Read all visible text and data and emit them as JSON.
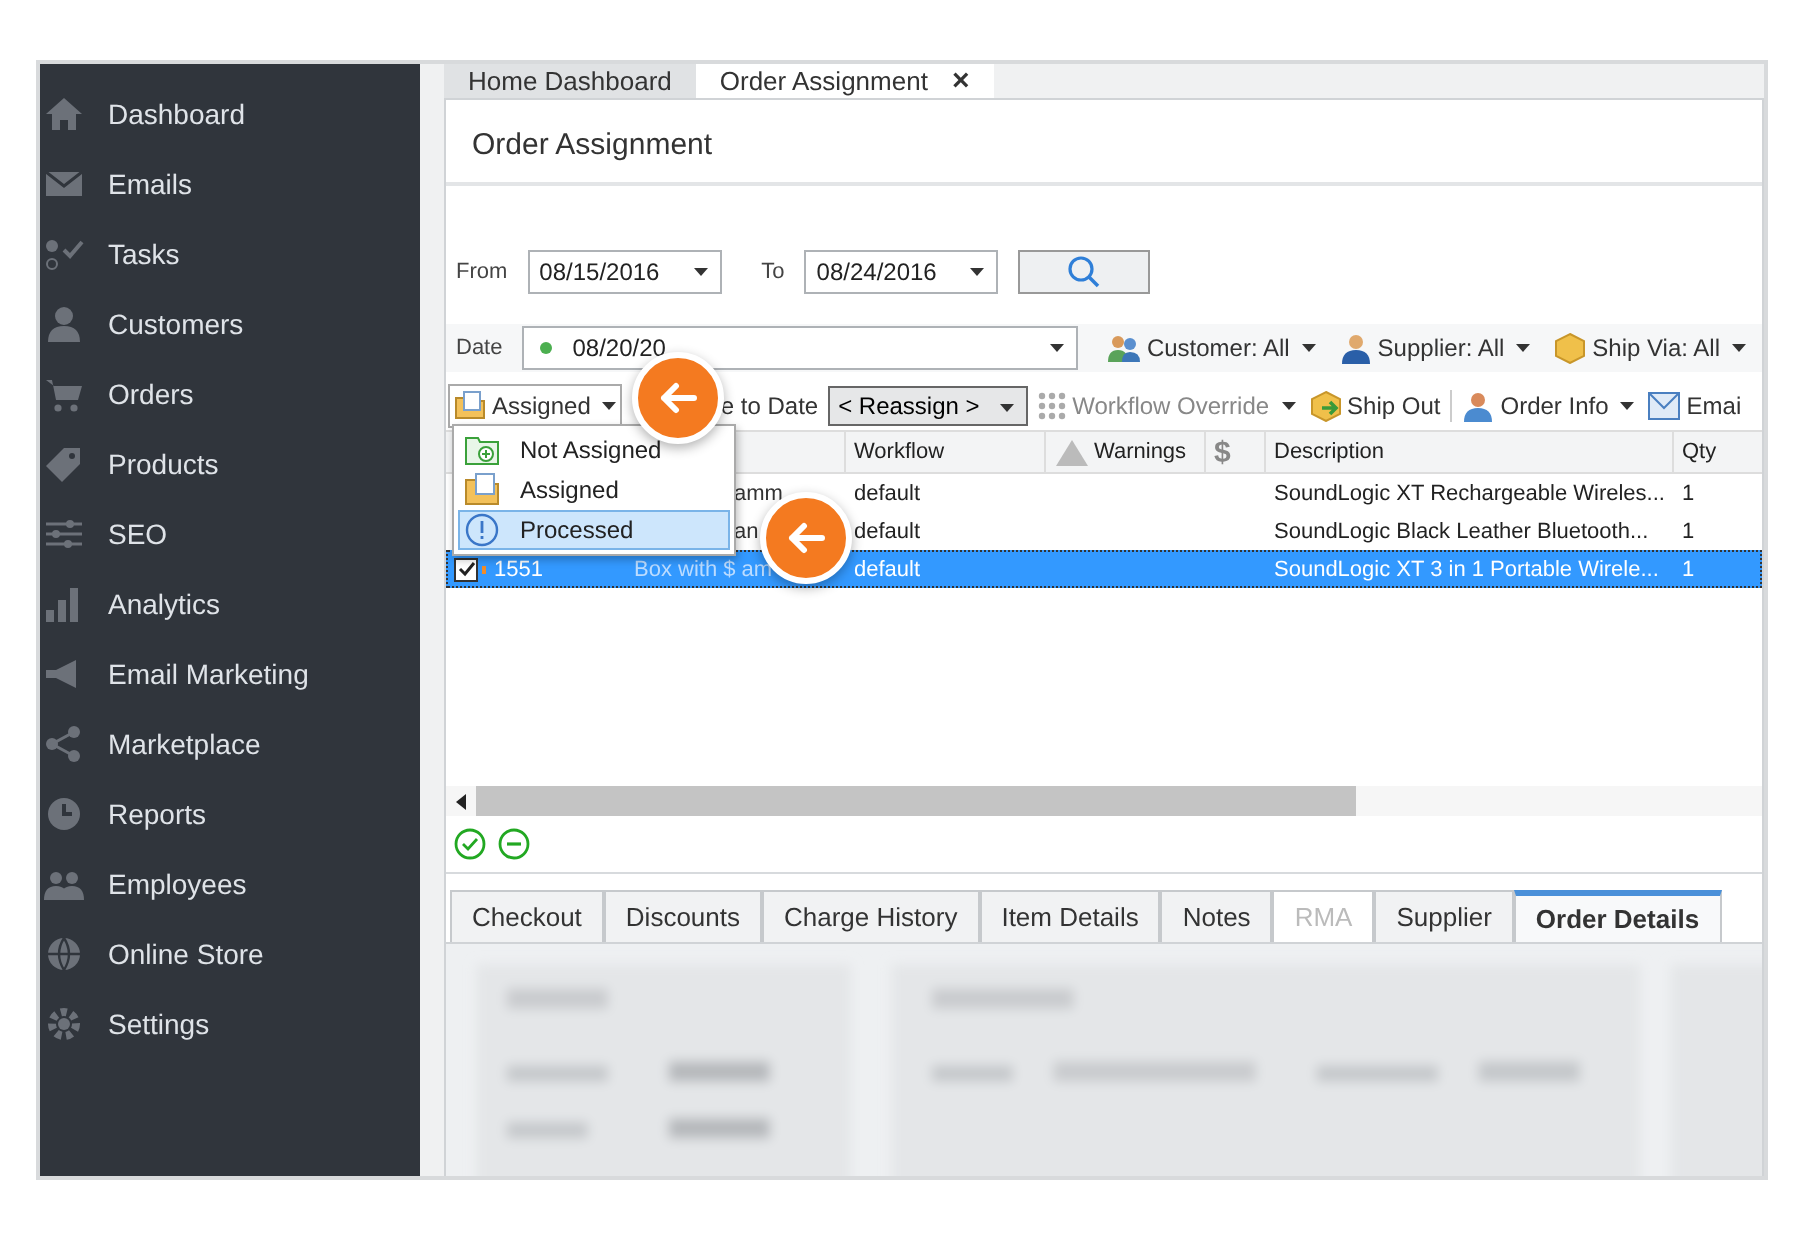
{
  "sidebar": {
    "items": [
      {
        "label": "Dashboard"
      },
      {
        "label": "Emails"
      },
      {
        "label": "Tasks"
      },
      {
        "label": "Customers"
      },
      {
        "label": "Orders"
      },
      {
        "label": "Products"
      },
      {
        "label": "SEO"
      },
      {
        "label": "Analytics"
      },
      {
        "label": "Email Marketing"
      },
      {
        "label": "Marketplace"
      },
      {
        "label": "Reports"
      },
      {
        "label": "Employees"
      },
      {
        "label": "Online Store"
      },
      {
        "label": "Settings"
      }
    ]
  },
  "tabs": [
    {
      "label": "Home Dashboard",
      "selected": false
    },
    {
      "label": "Order Assignment",
      "selected": true,
      "close": "×"
    }
  ],
  "page_title": "Order Assignment",
  "filters": {
    "from_label": "From",
    "from": "08/15/2016",
    "to_label": "To",
    "to": "08/24/2016",
    "date_label": "Date",
    "date": "08/20/20",
    "customer": "Customer: All",
    "supplier": "Supplier: All",
    "ship_via": "Ship Via: All"
  },
  "toolbar": {
    "status": "Assigned",
    "change_date": "e to Date",
    "reassign": "< Reassign >",
    "workflow_override": "Workflow Override",
    "ship_out": "Ship Out",
    "order_info": "Order Info",
    "email": "Emai"
  },
  "status_menu": {
    "items": [
      {
        "label": "Not Assigned",
        "selected": false
      },
      {
        "label": "Assigned",
        "selected": false
      },
      {
        "label": "Processed",
        "selected": true
      }
    ]
  },
  "table": {
    "columns": [
      "Workflow",
      "Warnings",
      "$",
      "Description",
      "Qty"
    ],
    "rows": [
      {
        "selected": false,
        "name": "amm",
        "workflow": "default",
        "description": "SoundLogic XT Rechargeable Wireles...",
        "qty": "1"
      },
      {
        "selected": false,
        "name": "an",
        "workflow": "default",
        "description": "SoundLogic Black Leather Bluetooth...",
        "qty": "1"
      },
      {
        "selected": true,
        "checked": true,
        "id": "1551",
        "name": "Box with $ am",
        "workflow": "default",
        "description": "SoundLogic XT 3 in 1 Portable Wirele...",
        "qty": "1"
      }
    ]
  },
  "detail_tabs": [
    {
      "label": "Checkout",
      "selected": false,
      "disabled": false
    },
    {
      "label": "Discounts",
      "selected": false,
      "disabled": false
    },
    {
      "label": "Charge History",
      "selected": false,
      "disabled": false
    },
    {
      "label": "Item Details",
      "selected": false,
      "disabled": false
    },
    {
      "label": "Notes",
      "selected": false,
      "disabled": false
    },
    {
      "label": "RMA",
      "selected": false,
      "disabled": true
    },
    {
      "label": "Supplier",
      "selected": false,
      "disabled": false
    },
    {
      "label": "Order Details",
      "selected": true,
      "disabled": false
    }
  ]
}
